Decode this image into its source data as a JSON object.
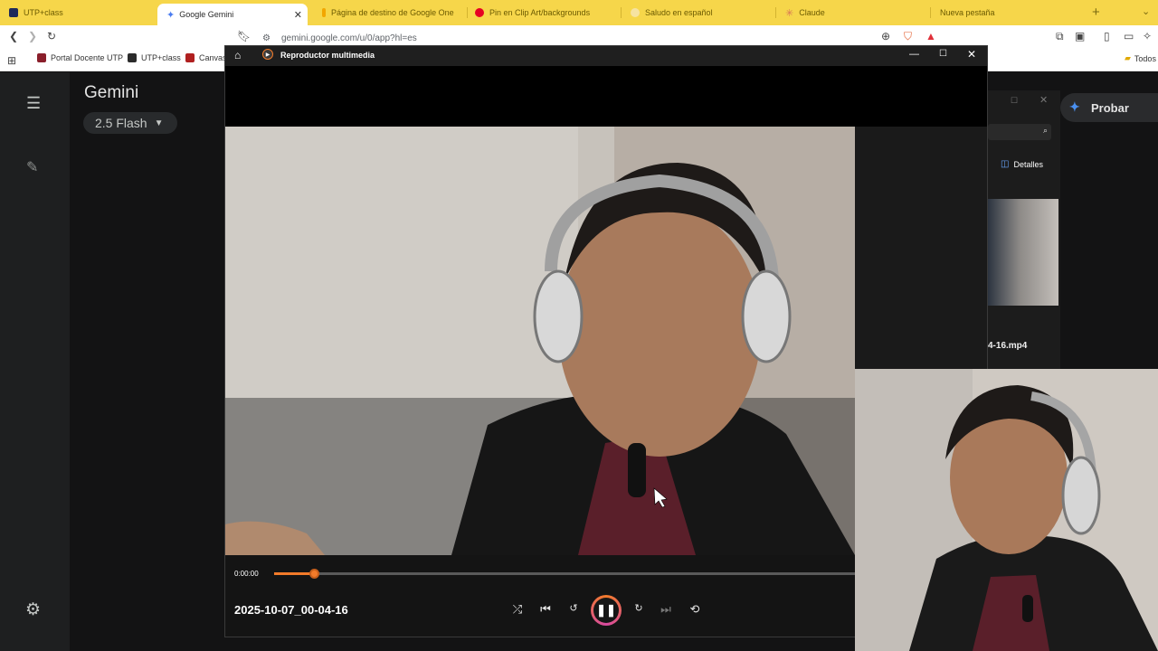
{
  "browser": {
    "tabs": [
      {
        "label": "UTP+class",
        "favicon_color": "#1f2a5a"
      },
      {
        "label": "Google Gemini",
        "favicon_color": "#4a7cf0",
        "active": true
      },
      {
        "label": "Página de destino de Google One",
        "favicon_color": "#f2a600"
      },
      {
        "label": "Pin en Clip Art/backgrounds",
        "favicon_color": "#e60023"
      },
      {
        "label": "Saludo en español",
        "favicon_color": "#f6e3a1"
      },
      {
        "label": "Claude",
        "favicon_color": "#d97757"
      },
      {
        "label": "Nueva pestaña",
        "favicon_color": "#f6d64a"
      }
    ],
    "new_tab_symbol": "+",
    "address": "gemini.google.com/u/0/app?hl=es",
    "bookmarks": [
      {
        "label": "Portal Docente UTP"
      },
      {
        "label": "UTP+class"
      },
      {
        "label": "Canvas"
      }
    ],
    "bookmarks_folder": "Todos"
  },
  "gemini": {
    "title": "Gemini",
    "model": "2.5 Flash",
    "try_button": "Probar"
  },
  "file_explorer": {
    "details_label": "Detalles",
    "filename_fragment": "4-16.mp4"
  },
  "player": {
    "app_title": "Reproductor multimedia",
    "time_elapsed": "0:00:00",
    "progress_fraction": 0.07,
    "media_title": "2025-10-07_00-04-16",
    "accent_color": "#f27b2a"
  }
}
